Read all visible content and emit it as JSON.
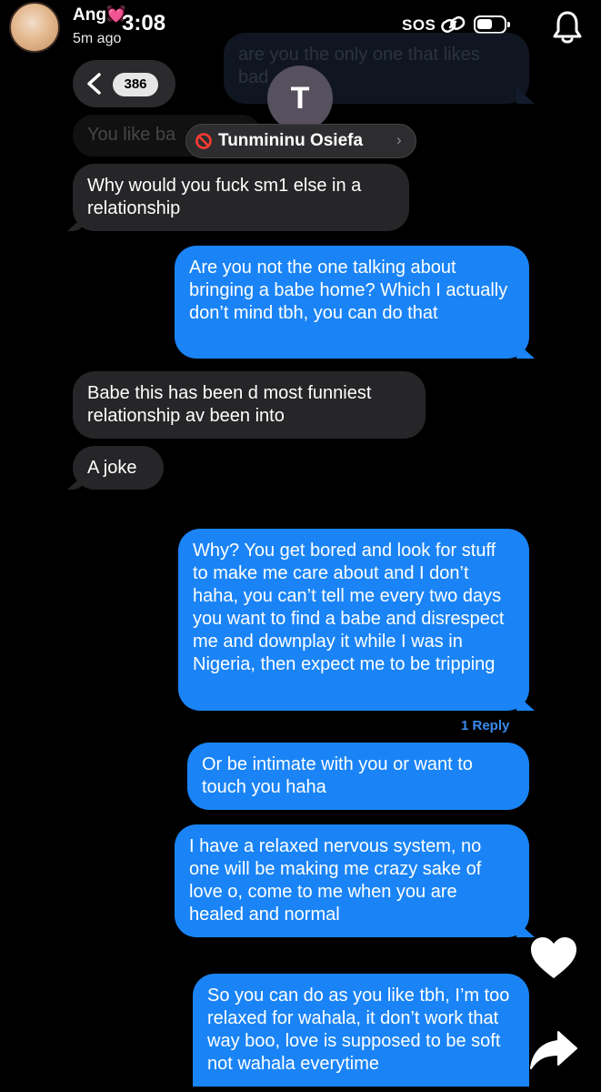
{
  "story": {
    "username": "Ang",
    "heart": "💓",
    "time": "3:08",
    "posted_ago": "5m ago",
    "sos": "SOS"
  },
  "thread": {
    "back_count": "386",
    "contact_initial": "T",
    "contact_name": "Tunmininu Osiefa",
    "contact_chevron": "›"
  },
  "messages": [
    {
      "from": "me",
      "text": "are you the only one that likes bad ... ?",
      "faded": true
    },
    {
      "from": "them",
      "text": "You like ba",
      "faded": true
    },
    {
      "from": "them",
      "text": "Why would you fuck sm1 else in a relationship"
    },
    {
      "from": "me",
      "text": "Are you not the one talking about bringing a babe home? Which I actually don’t mind tbh, you can do that"
    },
    {
      "from": "them",
      "text": "Babe this has been d most funniest relationship av been into"
    },
    {
      "from": "them",
      "text": "A joke"
    },
    {
      "from": "me",
      "text": "Why? You get bored and look for stuff to make me care about and I don’t haha, you can’t tell me every two days you want to find a babe and disrespect me and downplay it while I was in Nigeria, then expect me to be tripping"
    },
    {
      "from": "me",
      "text": "Or be intimate with you or want to touch you haha"
    },
    {
      "from": "me",
      "text": "I have a relaxed nervous system, no one will be making me crazy sake of love o, come to me when you are healed and normal"
    },
    {
      "from": "me",
      "text": "So you can do as you like tbh, I’m too relaxed for wahala, it don’t work that way boo, love is supposed to be soft not wahala everytime"
    }
  ],
  "reply_label": "1 Reply",
  "icons": {
    "link": "link-icon",
    "battery": "battery-icon",
    "bell": "bell-icon",
    "back": "chevron-left-icon",
    "blocked": "no-entry-icon",
    "like": "heart-icon",
    "share": "share-arrow-icon"
  },
  "colors": {
    "sent_bubble": "#1a84f6",
    "received_bubble": "#262628",
    "background": "#000000",
    "reply_link": "#3a8cf0"
  }
}
